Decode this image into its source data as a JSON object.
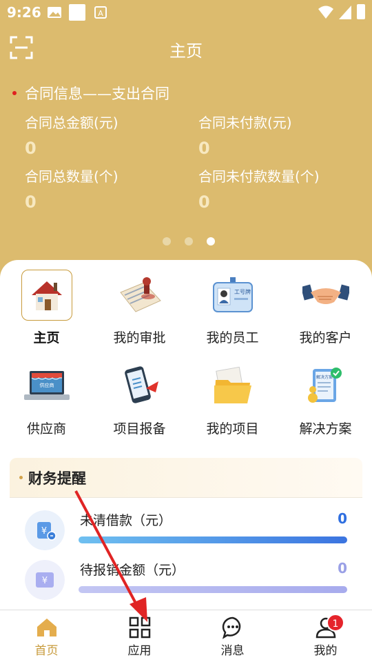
{
  "status_bar": {
    "time": "9:26"
  },
  "header": {
    "title": "主页"
  },
  "contract": {
    "title": "合同信息——支出合同",
    "stats": [
      {
        "label": "合同总金额(元)",
        "value": "0"
      },
      {
        "label": "合同未付款(元)",
        "value": "0"
      },
      {
        "label": "合同总数量(个)",
        "value": "0"
      },
      {
        "label": "合同未付款数量(个)",
        "value": "0"
      }
    ],
    "carousel_pages": 3,
    "carousel_active": 3
  },
  "grid": [
    {
      "label": "主页",
      "icon": "house-icon",
      "selected": true
    },
    {
      "label": "我的审批",
      "icon": "approval-stamp-icon"
    },
    {
      "label": "我的员工",
      "icon": "employee-badge-icon"
    },
    {
      "label": "我的客户",
      "icon": "handshake-icon"
    },
    {
      "label": "供应商",
      "icon": "laptop-shop-icon"
    },
    {
      "label": "项目报备",
      "icon": "phone-report-icon"
    },
    {
      "label": "我的项目",
      "icon": "folder-icon"
    },
    {
      "label": "解决方案",
      "icon": "solution-clipboard-icon"
    }
  ],
  "finance": {
    "title": "财务提醒",
    "rows": [
      {
        "label": "未清借款（元）",
        "value": "0",
        "icon": "loan-icon",
        "color": "#2f6fe0"
      },
      {
        "label": "待报销金额（元）",
        "value": "0",
        "icon": "reimburse-icon",
        "color": "#9aa0e6"
      }
    ]
  },
  "tabbar": [
    {
      "label": "首页",
      "icon": "home-icon",
      "active": true
    },
    {
      "label": "应用",
      "icon": "apps-grid-icon"
    },
    {
      "label": "消息",
      "icon": "message-icon"
    },
    {
      "label": "我的",
      "icon": "profile-icon",
      "badge": "1"
    }
  ],
  "colors": {
    "brand": "#dcbb6e",
    "accent": "#c79a3a",
    "badge": "#e5242b"
  }
}
